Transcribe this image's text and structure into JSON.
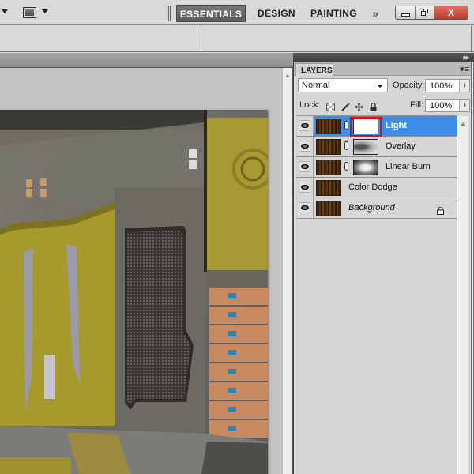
{
  "topbar": {
    "workspaces": [
      "ESSENTIALS",
      "DESIGN",
      "PAINTING"
    ],
    "active_workspace": "ESSENTIALS",
    "more_label": "»",
    "window_controls": {
      "close_label": "X"
    }
  },
  "layers_panel": {
    "tab_label": "LAYERS",
    "blend_mode": "Normal",
    "opacity_label": "Opacity:",
    "opacity_value": "100%",
    "lock_label": "Lock:",
    "fill_label": "Fill:",
    "fill_value": "100%",
    "layers": [
      {
        "name": "Light",
        "visible": true,
        "has_mask": true,
        "mask": "white",
        "selected": true,
        "mask_highlighted": true
      },
      {
        "name": "Overlay",
        "visible": true,
        "has_mask": true,
        "mask": "overlay",
        "selected": false
      },
      {
        "name": "Linear Burn",
        "visible": true,
        "has_mask": true,
        "mask": "burn",
        "selected": false
      },
      {
        "name": "Color Dodge",
        "visible": true,
        "has_mask": false,
        "selected": false
      },
      {
        "name": "Background",
        "visible": true,
        "has_mask": false,
        "selected": false,
        "locked": true,
        "italic": true
      }
    ]
  },
  "colors": {
    "selection": "#3d8ee8",
    "highlight_box": "#d2101a",
    "close_button": "#c84a3a"
  }
}
